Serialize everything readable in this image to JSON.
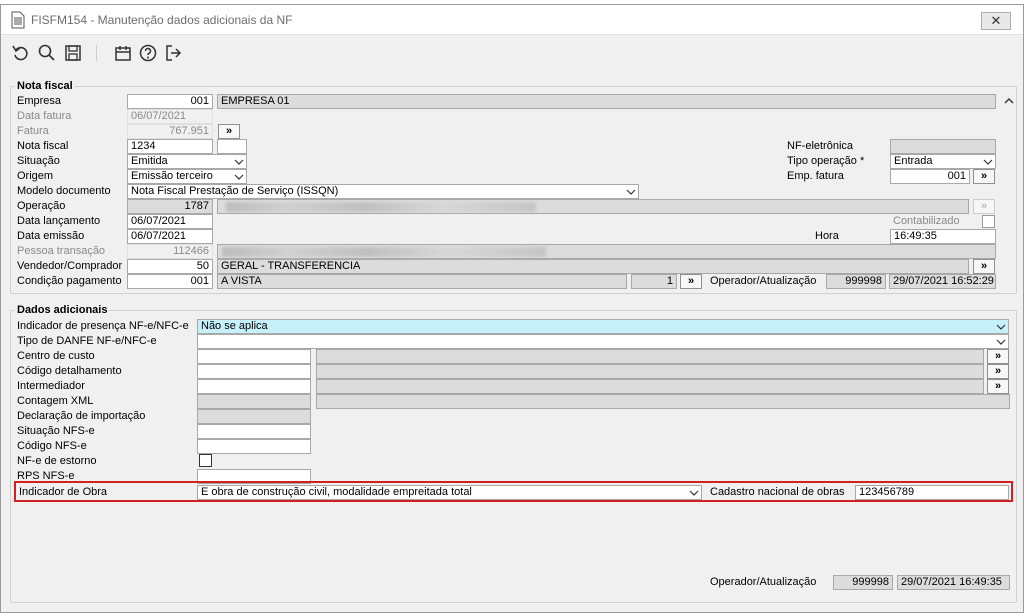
{
  "window": {
    "title": "FISFM154 - Manutenção dados adicionais da NF",
    "close_label": "✕"
  },
  "nota_fiscal": {
    "legend": "Nota fiscal",
    "empresa": {
      "label": "Empresa",
      "code": "001",
      "name": "EMPRESA 01"
    },
    "data_fatura": {
      "label": "Data fatura",
      "value": "06/07/2021"
    },
    "fatura": {
      "label": "Fatura",
      "value": "767.951",
      "button": "»"
    },
    "nota_fiscal_field": {
      "label": "Nota fiscal",
      "value": "1234",
      "serie": ""
    },
    "nf_eletronica": {
      "label": "NF-eletrônica",
      "value": ""
    },
    "situacao": {
      "label": "Situação",
      "value": "Emitida"
    },
    "tipo_operacao": {
      "label": "Tipo operação *",
      "value": "Entrada"
    },
    "origem": {
      "label": "Origem",
      "value": "Emissão terceiro"
    },
    "emp_fatura": {
      "label": "Emp. fatura",
      "value": "001",
      "button": "»"
    },
    "modelo_documento": {
      "label": "Modelo documento",
      "value": "Nota Fiscal Prestação de Serviço (ISSQN)"
    },
    "operacao": {
      "label": "Operação",
      "value": "1787"
    },
    "contabilizado": {
      "label": "Contabilizado"
    },
    "data_lancamento": {
      "label": "Data lançamento",
      "value": "06/07/2021"
    },
    "data_emissao": {
      "label": "Data emissão",
      "value": "06/07/2021"
    },
    "hora": {
      "label": "Hora",
      "value": "16:49:35"
    },
    "pessoa_transacao": {
      "label": "Pessoa transação",
      "value": "112466"
    },
    "vendedor": {
      "label": "Vendedor/Comprador",
      "code": "50",
      "name": "GERAL - TRANSFERENCIA",
      "button": "»"
    },
    "condicao_pagamento": {
      "label": "Condição pagamento",
      "code": "001",
      "name": "A VISTA",
      "parcelas": "1",
      "button": "»"
    },
    "operador_atualizacao": {
      "label": "Operador/Atualização",
      "operador": "999998",
      "data": "29/07/2021 16:52:29"
    }
  },
  "dados_adicionais": {
    "legend": "Dados adicionais",
    "indicador_presenca": {
      "label": "Indicador de presença NF-e/NFC-e",
      "value": "Não se aplica"
    },
    "tipo_danfe": {
      "label": "Tipo de DANFE NF-e/NFC-e",
      "value": ""
    },
    "centro_custo": {
      "label": "Centro de custo",
      "button": "»"
    },
    "codigo_detalhamento": {
      "label": "Código detalhamento",
      "button": "»"
    },
    "intermediador": {
      "label": "Intermediador",
      "button": "»"
    },
    "contagem_xml": {
      "label": "Contagem XML"
    },
    "declaracao_importacao": {
      "label": "Declaração de importação"
    },
    "situacao_nfse": {
      "label": "Situação NFS-e"
    },
    "codigo_nfse": {
      "label": "Código NFS-e"
    },
    "nfe_estorno": {
      "label": "NF-e de estorno"
    },
    "rps_nfse": {
      "label": "RPS NFS-e"
    },
    "indicador_obra": {
      "label": "Indicador de Obra",
      "value": "E obra de construção civil, modalidade empreitada total"
    },
    "cadastro_obras": {
      "label": "Cadastro nacional de obras",
      "value": "123456789"
    },
    "operador_atualizacao": {
      "label": "Operador/Atualização",
      "operador": "999998",
      "data": "29/07/2021 16:49:35"
    }
  },
  "icons": [
    "document-icon",
    "undo-icon",
    "search-icon",
    "save-icon",
    "calendar-icon",
    "help-icon",
    "exit-icon"
  ]
}
